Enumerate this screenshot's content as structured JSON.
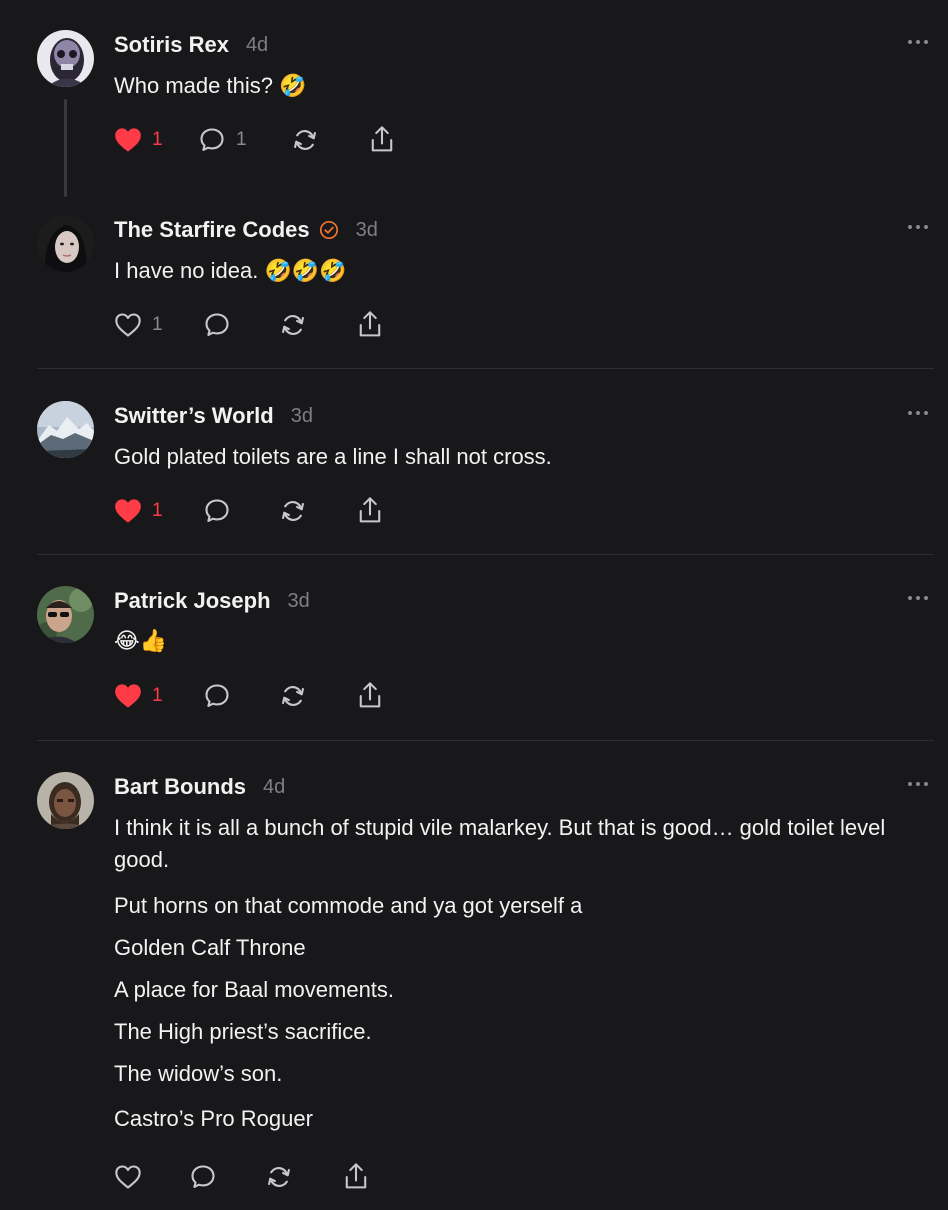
{
  "colors": {
    "background": "#18181a",
    "text": "#f2f2f2",
    "muted": "#7f7f84",
    "like_red": "#ff3b48",
    "verified_orange": "#f0752e",
    "divider": "#2e2e31"
  },
  "posts": [
    {
      "author": "Sotiris Rex",
      "time": "4d",
      "verified": false,
      "text": [
        "Who made this? 🤣"
      ],
      "likes": "1",
      "liked": true,
      "replies": "1",
      "avatar_icon": "skull-avatar"
    },
    {
      "author": "The Starfire Codes",
      "time": "3d",
      "verified": true,
      "text": [
        "I have no idea. 🤣🤣🤣"
      ],
      "likes": "1",
      "liked": false,
      "replies": "",
      "avatar_icon": "woman-avatar"
    },
    {
      "author": "Switter’s World",
      "time": "3d",
      "verified": false,
      "text": [
        "Gold plated toilets are a line I shall not cross."
      ],
      "likes": "1",
      "liked": true,
      "replies": "",
      "avatar_icon": "mountain-avatar"
    },
    {
      "author": "Patrick Joseph",
      "time": "3d",
      "verified": false,
      "text": [
        "😂👍"
      ],
      "likes": "1",
      "liked": true,
      "replies": "",
      "avatar_icon": "man-sunglasses-avatar"
    },
    {
      "author": "Bart Bounds",
      "time": "4d",
      "verified": false,
      "text": [
        "I think it is all a bunch of stupid vile malarkey. But that is good… gold toilet level good.",
        "Put horns on that commode and ya got yerself a",
        "Golden Calf Throne",
        "A place for Baal movements.",
        "The High priest’s sacrifice.",
        "The widow’s son.",
        "Castro’s Pro Roguer"
      ],
      "likes": "",
      "liked": false,
      "replies": "",
      "avatar_icon": "caveman-avatar"
    }
  ]
}
